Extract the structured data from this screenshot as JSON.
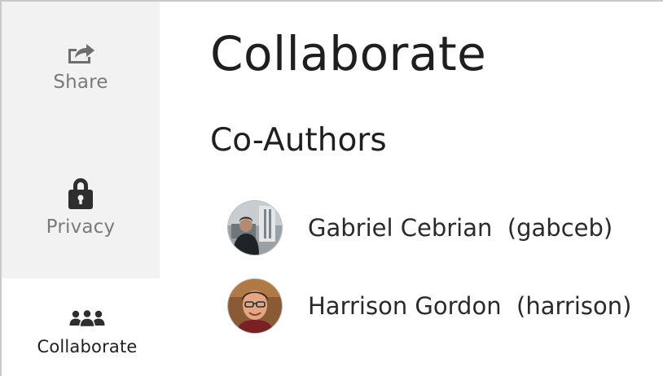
{
  "sidebar": {
    "items": [
      {
        "label": "Share",
        "icon": "share-icon",
        "state": "inactive"
      },
      {
        "label": "Privacy",
        "icon": "lock-icon",
        "state": "inactive"
      },
      {
        "label": "Collaborate",
        "icon": "people-icon",
        "state": "active"
      }
    ]
  },
  "main": {
    "title": "Collaborate",
    "section_title": "Co-Authors",
    "authors": [
      {
        "name": "Gabriel Cebrian",
        "username": "(gabceb)",
        "display": "Gabriel Cebrian  (gabceb)"
      },
      {
        "name": "Harrison Gordon",
        "username": "(harrison)",
        "display": "Harrison Gordon  (harrison)"
      }
    ]
  },
  "colors": {
    "sidebar_inactive_bg": "#f2f2f2",
    "sidebar_active_bg": "#ffffff",
    "text_primary": "#1f1f1f",
    "text_muted": "#7a7a7a"
  }
}
